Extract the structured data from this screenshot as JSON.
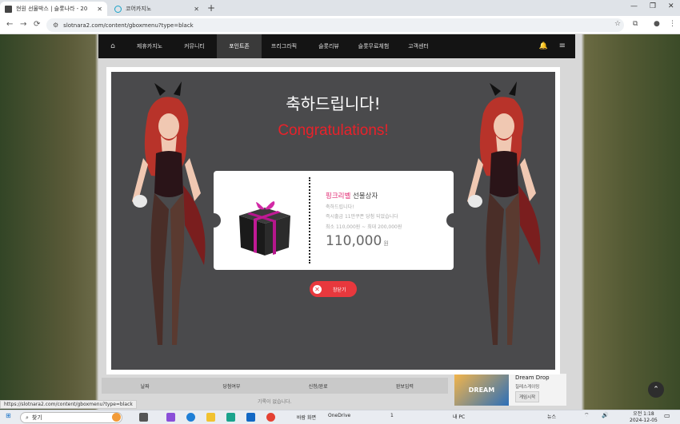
{
  "browser": {
    "tabs": [
      {
        "title": "현원 선물박스 | 슬롯나라 - 20",
        "active": true
      },
      {
        "title": "코어카지노",
        "active": false
      }
    ],
    "url": "slotnara2.com/content/gboxmenu?type=black",
    "status_url": "https://slotnara2.com/content/gboxmenu?type=black"
  },
  "site_nav": {
    "items": [
      "제휴카지노",
      "커뮤니티",
      "포인트존",
      "프리그라픽",
      "슬롯리뷰",
      "슬롯무료체험",
      "고객센터"
    ],
    "active": "포인트존"
  },
  "modal": {
    "title_kr": "축하드립니다!",
    "title_en": "Congratulations!",
    "prize_name_pink": "핑크리벨",
    "prize_name_rest": " 선물상자",
    "line1": "축하드립니다!",
    "line2": "즉시출금 11만쿠폰 당첨 되었습니다",
    "line3": "최소 110,000원 ~ 최대 200,000원",
    "amount": "110,000",
    "amount_unit": "원",
    "close_label": "창닫기"
  },
  "lower_table": {
    "headers": [
      "날짜",
      "당첨여부",
      "신청/완료",
      "완보입력"
    ],
    "empty_text": "기록이 없습니다."
  },
  "promo": {
    "logo_text": "DREAM",
    "title": "Dream Drop",
    "subtitle": "칠레스게이밍",
    "button": "게임시작"
  },
  "taskbar": {
    "search_placeholder": "찾기",
    "weather": "바람 화면",
    "onedrive": "OneDrive",
    "people_count": "1",
    "pc_label": "내 PC",
    "news": "뉴스",
    "time": "오전 1:18",
    "date": "2024-12-05"
  },
  "colors": {
    "accent_red": "#e8222a",
    "prize_pink": "#e0226e",
    "close_btn": "#e8383d",
    "modal_bg": "#4a4a4c"
  }
}
